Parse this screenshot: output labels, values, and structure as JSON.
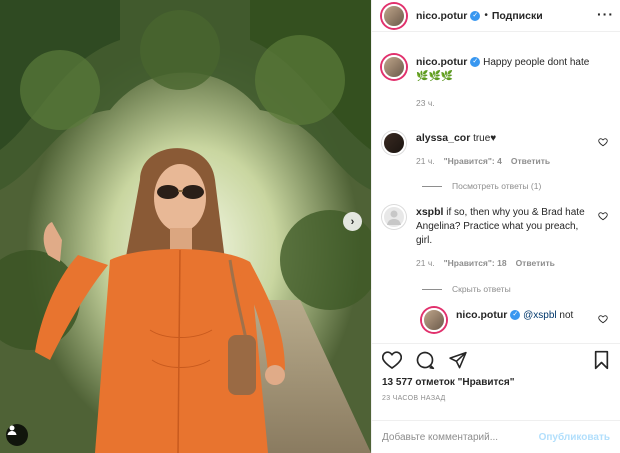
{
  "post": {
    "author": "nico.potur",
    "follow_separator": "•",
    "follow_label": "Подписки",
    "caption_text": "Happy people dont hate",
    "caption_emoji": "🌿🌿🌿",
    "caption_time": "23 ч."
  },
  "comments": [
    {
      "user": "alyssa_cor",
      "text": "true♥",
      "time": "21 ч.",
      "likes": "\"Нравится\": 4",
      "reply": "Ответить",
      "replies_label": "Посмотреть ответы (1)"
    },
    {
      "user": "xspbl",
      "text": "if so, then why you & Brad hate Angelina? Practice what you preach, girl.",
      "time": "21 ч.",
      "likes": "\"Нравится\": 18",
      "reply": "Ответить",
      "replies_label": "Скрыть ответы"
    },
    {
      "user": "nico.potur",
      "mention": "@xspbl",
      "text": "not"
    }
  ],
  "footer": {
    "likes_label": "13 577 отметок \"Нравится\"",
    "timestamp": "23 часов назад",
    "comment_placeholder": "Добавьте комментарий...",
    "publish_label": "Опубликовать"
  },
  "colors": {
    "verified": "#3897f0",
    "dress": "#e8742f",
    "link": "#b2dffc"
  },
  "icons": [
    "heart-icon",
    "comment-icon",
    "share-icon",
    "bookmark-icon",
    "more-icon",
    "chevron-right-icon",
    "user-tag-icon",
    "verified-icon"
  ]
}
